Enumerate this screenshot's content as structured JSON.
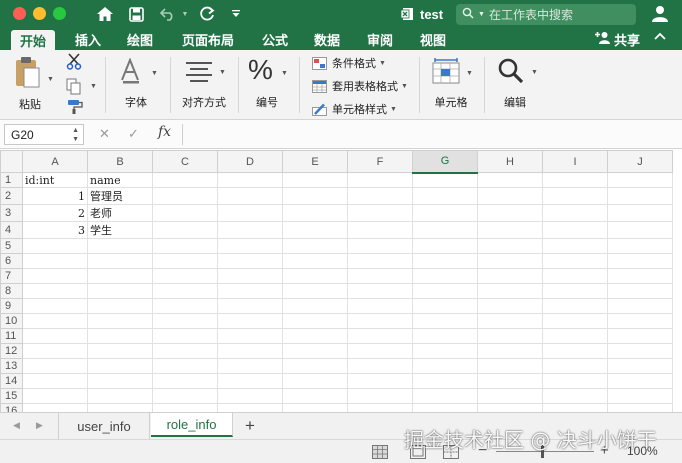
{
  "window": {
    "title": "test",
    "search_placeholder": "在工作表中搜索"
  },
  "quick_access": [
    "home-icon",
    "save-icon",
    "undo-icon",
    "redo-icon",
    "customize-icon"
  ],
  "ribbon_tabs": [
    "开始",
    "插入",
    "绘图",
    "页面布局",
    "公式",
    "数据",
    "审阅",
    "视图"
  ],
  "active_tab": "开始",
  "share_label": "共享",
  "ribbon": {
    "paste": "粘贴",
    "font": "字体",
    "align": "对齐方式",
    "number": "编号",
    "conditional": "条件格式",
    "table_format": "套用表格格式",
    "cell_style": "单元格样式",
    "cells": "单元格",
    "edit": "编辑"
  },
  "formula_bar": {
    "name_box": "G20",
    "formula": "",
    "fx": "fx"
  },
  "columns": [
    "A",
    "B",
    "C",
    "D",
    "E",
    "F",
    "G",
    "H",
    "I",
    "J"
  ],
  "selected_column": "G",
  "rows": [
    {
      "n": "1",
      "a": "id:int",
      "b": "name"
    },
    {
      "n": "2",
      "a": "1",
      "b": "管理员"
    },
    {
      "n": "3",
      "a": "2",
      "b": "老师"
    },
    {
      "n": "4",
      "a": "3",
      "b": "学生"
    },
    {
      "n": "5",
      "a": "",
      "b": ""
    },
    {
      "n": "6",
      "a": "",
      "b": ""
    },
    {
      "n": "7",
      "a": "",
      "b": ""
    },
    {
      "n": "8",
      "a": "",
      "b": ""
    },
    {
      "n": "9",
      "a": "",
      "b": ""
    },
    {
      "n": "10",
      "a": "",
      "b": ""
    },
    {
      "n": "11",
      "a": "",
      "b": ""
    },
    {
      "n": "12",
      "a": "",
      "b": ""
    },
    {
      "n": "13",
      "a": "",
      "b": ""
    },
    {
      "n": "14",
      "a": "",
      "b": ""
    },
    {
      "n": "15",
      "a": "",
      "b": ""
    },
    {
      "n": "16",
      "a": "",
      "b": ""
    }
  ],
  "sheets": [
    "user_info",
    "role_info"
  ],
  "active_sheet": "role_info",
  "add_sheet": "+",
  "zoom": {
    "level": "100%",
    "minus": "−",
    "plus": "+"
  },
  "watermark": "掘金技术社区 @ 决斗小饼干",
  "colors": {
    "excel_green": "#217346",
    "ribbon_bg": "#f3f3f3"
  }
}
